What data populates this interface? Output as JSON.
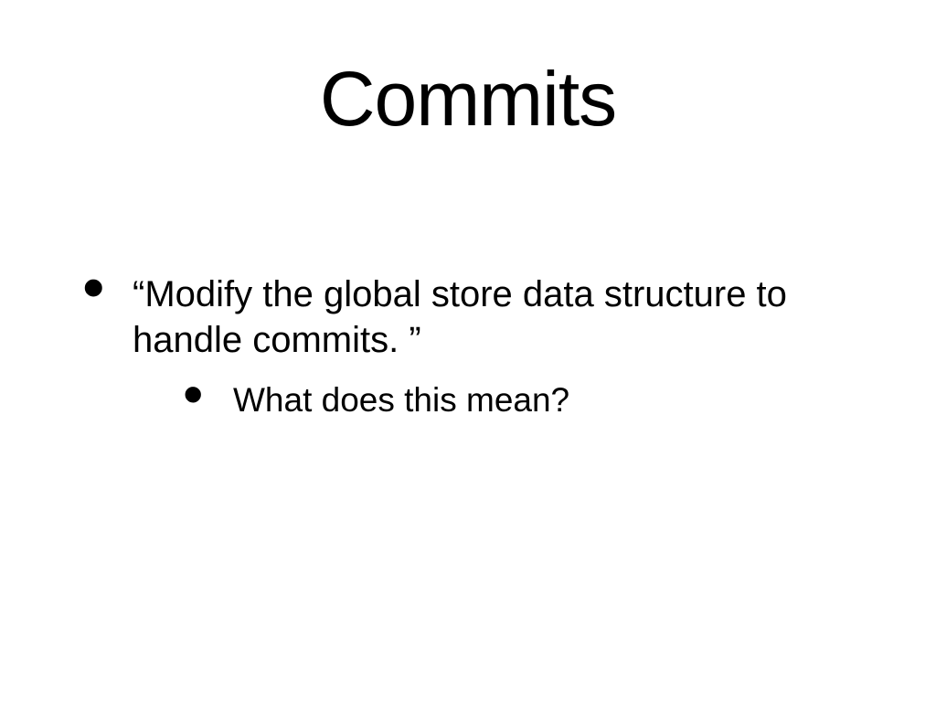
{
  "slide": {
    "title": "Commits",
    "bullets": [
      {
        "text": "“Modify the global store data structure to handle commits. ”",
        "children": [
          {
            "text": "What does this mean?"
          }
        ]
      }
    ]
  }
}
